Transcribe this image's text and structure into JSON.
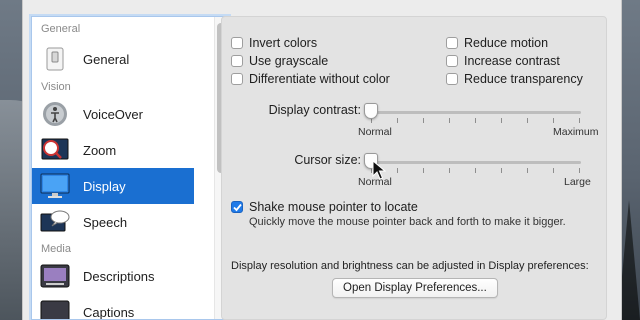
{
  "sidebar": {
    "sections": [
      {
        "header": "General",
        "items": [
          {
            "label": "General",
            "icon": "switch-icon"
          }
        ]
      },
      {
        "header": "Vision",
        "items": [
          {
            "label": "VoiceOver",
            "icon": "voiceover-icon"
          },
          {
            "label": "Zoom",
            "icon": "zoom-icon"
          },
          {
            "label": "Display",
            "icon": "display-icon",
            "selected": true
          },
          {
            "label": "Speech",
            "icon": "speech-icon"
          }
        ]
      },
      {
        "header": "Media",
        "items": [
          {
            "label": "Descriptions",
            "icon": "descriptions-icon"
          },
          {
            "label": "Captions",
            "icon": "captions-icon"
          }
        ]
      }
    ]
  },
  "display": {
    "checkboxes_left": [
      {
        "label": "Invert colors",
        "checked": false
      },
      {
        "label": "Use grayscale",
        "checked": false
      },
      {
        "label": "Differentiate without color",
        "checked": false
      }
    ],
    "checkboxes_right": [
      {
        "label": "Reduce motion",
        "checked": false
      },
      {
        "label": "Increase contrast",
        "checked": false
      },
      {
        "label": "Reduce transparency",
        "checked": false
      }
    ],
    "contrast_slider": {
      "label": "Display contrast:",
      "min_label": "Normal",
      "max_label": "Maximum",
      "value": 0
    },
    "cursor_slider": {
      "label": "Cursor size:",
      "min_label": "Normal",
      "max_label": "Large",
      "value": 0
    },
    "shake": {
      "label": "Shake mouse pointer to locate",
      "checked": true,
      "description": "Quickly move the mouse pointer back and forth to make it bigger."
    },
    "note": "Display resolution and brightness can be adjusted in Display preferences:",
    "open_button": "Open Display Preferences..."
  },
  "colors": {
    "accent": "#1a6fd1",
    "checkbox_checked": "#1f7ae8"
  }
}
